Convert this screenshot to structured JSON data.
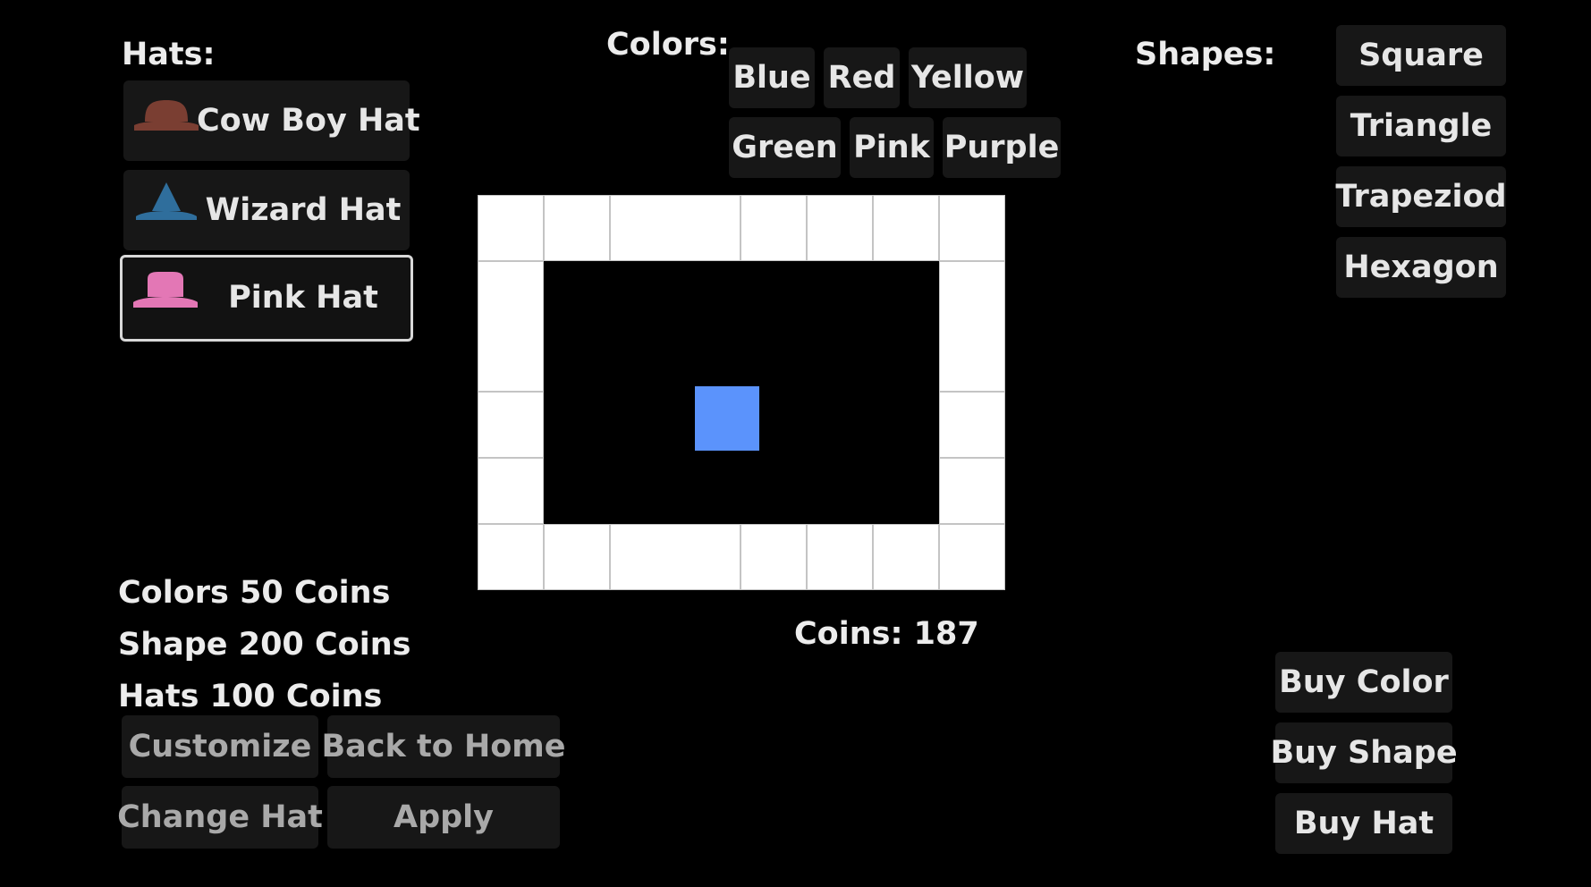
{
  "hats": {
    "heading": "Hats:",
    "items": [
      {
        "label": "Cow Boy Hat",
        "icon": "cowboy-hat-icon",
        "color": "#7a3e32"
      },
      {
        "label": "Wizard Hat",
        "icon": "wizard-hat-icon",
        "color": "#2f6e9c"
      },
      {
        "label": "Pink Hat",
        "icon": "pink-hat-icon",
        "color": "#e377b5"
      }
    ],
    "selected": "Pink Hat"
  },
  "colors": {
    "heading": "Colors:",
    "options": [
      "Blue",
      "Red",
      "Yellow",
      "Green",
      "Pink",
      "Purple"
    ]
  },
  "shapes": {
    "heading": "Shapes:",
    "options": [
      "Square",
      "Triangle",
      "Trapeziod",
      "Hexagon"
    ]
  },
  "prices": {
    "colors": "Colors 50 Coins",
    "shape": "Shape 200 Coins",
    "hats": "Hats 100 Coins"
  },
  "coins": {
    "text": "Coins: 187"
  },
  "player": {
    "color": "#5b93fc",
    "shape": "square"
  },
  "board": {
    "tile_color": "#ffffff",
    "background": "#000000"
  },
  "actions": {
    "customize": "Customize",
    "back_home": "Back to Home",
    "change_hat": "Change Hat",
    "apply": "Apply"
  },
  "store": {
    "buy_color": "Buy Color",
    "buy_shape": "Buy Shape",
    "buy_hat": "Buy Hat"
  }
}
